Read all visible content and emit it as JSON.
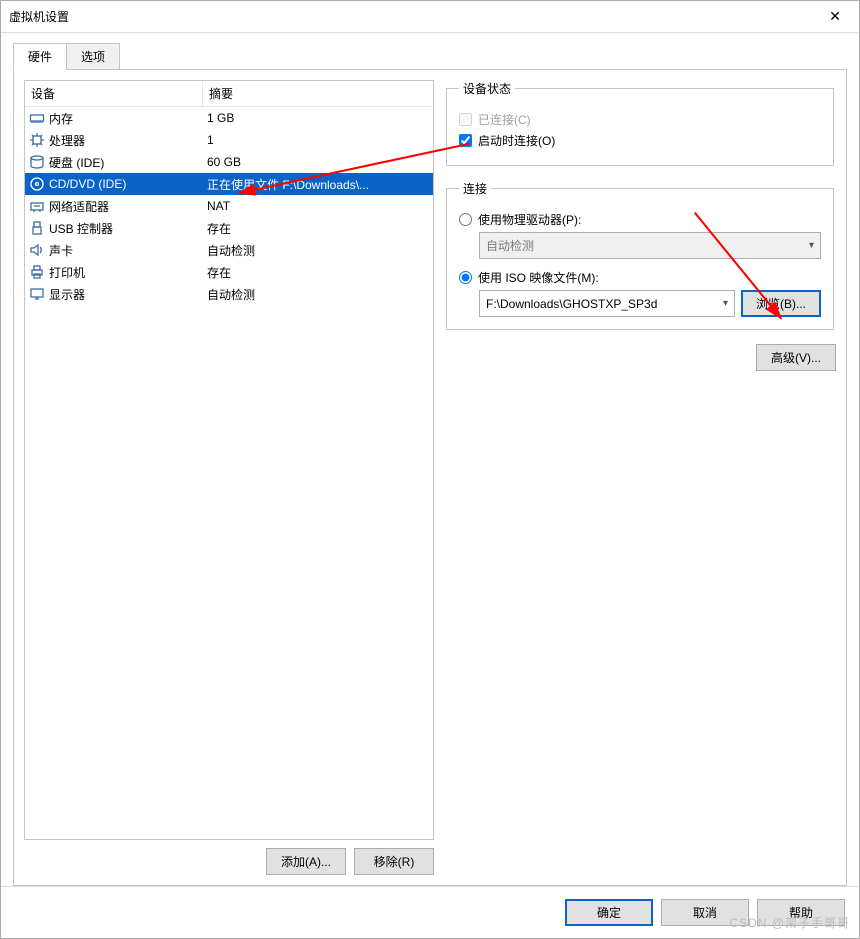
{
  "window": {
    "title": "虚拟机设置"
  },
  "tabs": {
    "hardware": "硬件",
    "options": "选项"
  },
  "columns": {
    "device": "设备",
    "summary": "摘要"
  },
  "devices": [
    {
      "icon": "memory",
      "name": "内存",
      "summary": "1 GB"
    },
    {
      "icon": "cpu",
      "name": "处理器",
      "summary": "1"
    },
    {
      "icon": "disk",
      "name": "硬盘 (IDE)",
      "summary": "60 GB"
    },
    {
      "icon": "cd",
      "name": "CD/DVD (IDE)",
      "summary": "正在使用文件 F:\\Downloads\\..."
    },
    {
      "icon": "net",
      "name": "网络适配器",
      "summary": "NAT"
    },
    {
      "icon": "usb",
      "name": "USB 控制器",
      "summary": "存在"
    },
    {
      "icon": "sound",
      "name": "声卡",
      "summary": "自动检测"
    },
    {
      "icon": "printer",
      "name": "打印机",
      "summary": "存在"
    },
    {
      "icon": "display",
      "name": "显示器",
      "summary": "自动检测"
    }
  ],
  "selectedIndex": 3,
  "leftButtons": {
    "add": "添加(A)...",
    "remove": "移除(R)"
  },
  "status": {
    "legend": "设备状态",
    "connected": "已连接(C)",
    "connectAtPowerOn": "启动时连接(O)"
  },
  "connection": {
    "legend": "连接",
    "physical": "使用物理驱动器(P):",
    "physicalValue": "自动检测",
    "iso": "使用 ISO 映像文件(M):",
    "isoValue": "F:\\Downloads\\GHOSTXP_SP3d",
    "browse": "浏览(B)..."
  },
  "advanced": "高级(V)...",
  "footer": {
    "ok": "确定",
    "cancel": "取消",
    "help": "帮助"
  },
  "watermark": "CSDN @架子手哥哥"
}
